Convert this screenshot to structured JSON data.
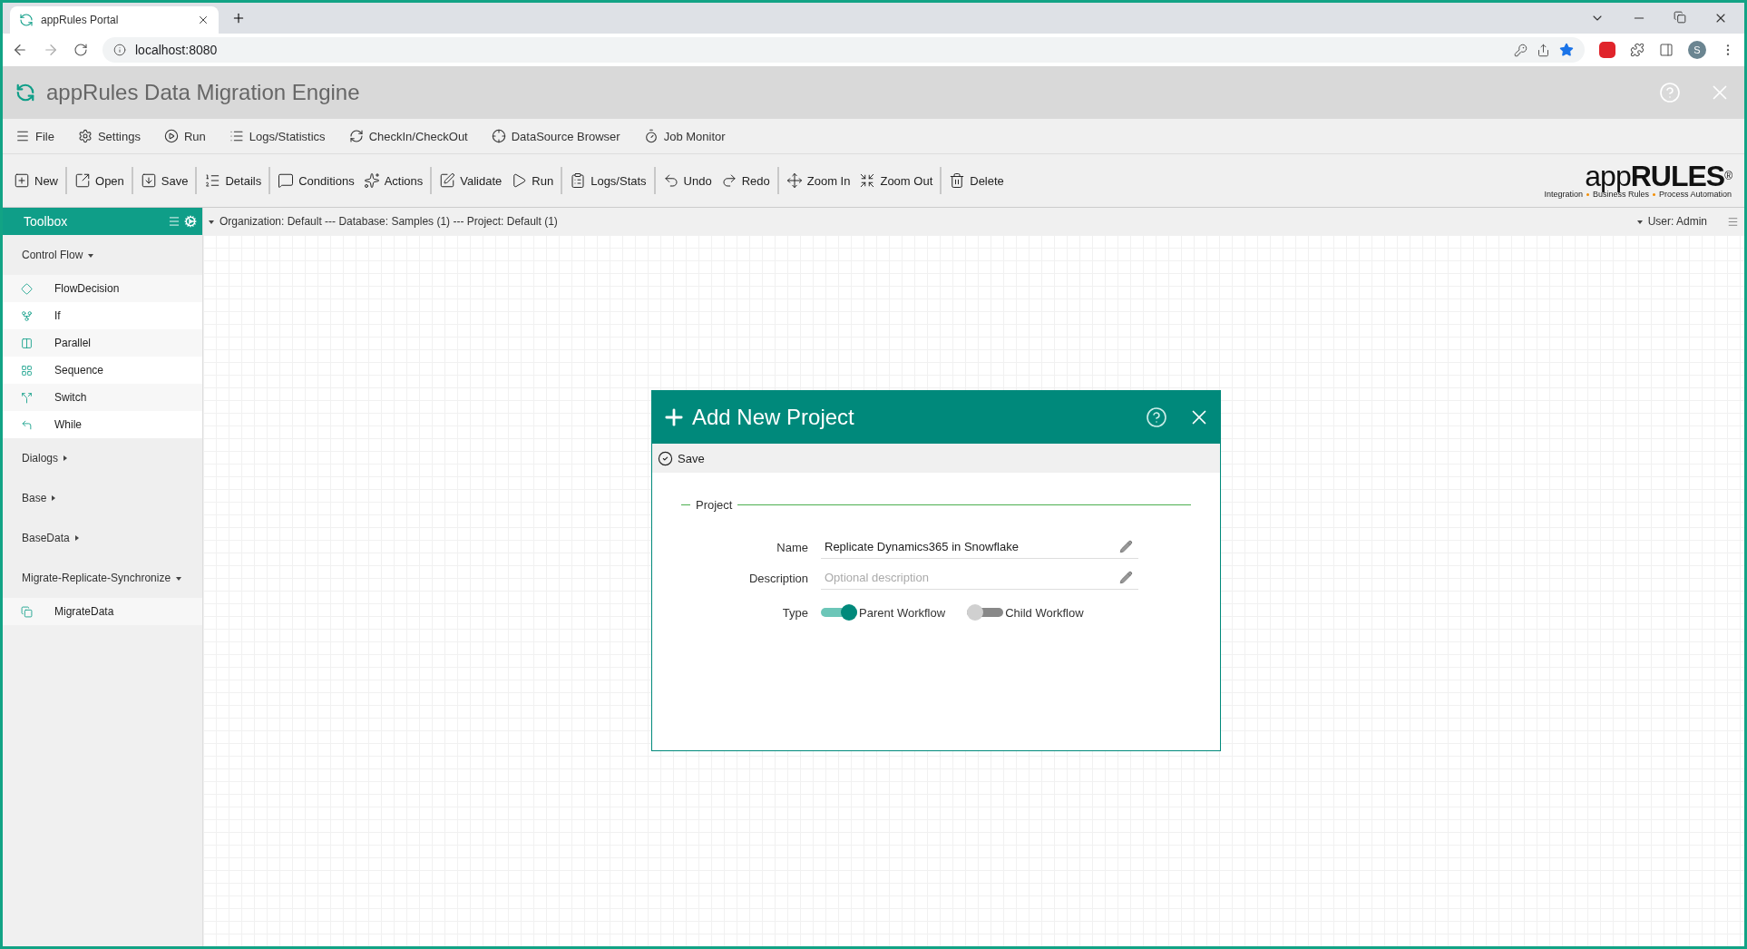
{
  "browser": {
    "tab_title": "appRules Portal",
    "url": "localhost:8080",
    "profile_initial": "S"
  },
  "app": {
    "title": "appRules Data Migration Engine"
  },
  "menu": [
    {
      "label": "File"
    },
    {
      "label": "Settings"
    },
    {
      "label": "Run"
    },
    {
      "label": "Logs/Statistics"
    },
    {
      "label": "CheckIn/CheckOut"
    },
    {
      "label": "DataSource Browser"
    },
    {
      "label": "Job Monitor"
    }
  ],
  "toolbar": [
    [
      {
        "label": "New"
      }
    ],
    [
      {
        "label": "Open"
      }
    ],
    [
      {
        "label": "Save"
      }
    ],
    [
      {
        "label": "Details"
      }
    ],
    [
      {
        "label": "Conditions"
      },
      {
        "label": "Actions"
      }
    ],
    [
      {
        "label": "Validate"
      },
      {
        "label": "Run"
      }
    ],
    [
      {
        "label": "Logs/Stats"
      }
    ],
    [
      {
        "label": "Undo"
      },
      {
        "label": "Redo"
      }
    ],
    [
      {
        "label": "Zoom In"
      },
      {
        "label": "Zoom Out"
      }
    ],
    [
      {
        "label": "Delete"
      }
    ]
  ],
  "logo": {
    "wordmark": "app**RULES**$^{®}$",
    "tagline": [
      "Integration",
      "Business Rules",
      "Process Automation"
    ]
  },
  "toolbox": {
    "title": "Toolbox",
    "groups": [
      {
        "label": "Control Flow",
        "expanded": true,
        "items": [
          {
            "label": "FlowDecision"
          },
          {
            "label": "If"
          },
          {
            "label": "Parallel"
          },
          {
            "label": "Sequence"
          },
          {
            "label": "Switch"
          },
          {
            "label": "While"
          }
        ]
      },
      {
        "label": "Dialogs",
        "expanded": false
      },
      {
        "label": "Base",
        "expanded": false
      },
      {
        "label": "BaseData",
        "expanded": false
      },
      {
        "label": "Migrate-Replicate-Synchronize",
        "expanded": true,
        "items": [
          {
            "label": "MigrateData"
          }
        ]
      }
    ]
  },
  "breadcrumb": {
    "path": "Organization: Default --- Database: Samples (1) --- Project: Default (1)",
    "user": "User: Admin"
  },
  "dialog": {
    "title": "Add New Project",
    "save_label": "Save",
    "section": "Project",
    "fields": [
      {
        "label": "Name",
        "value": "Replicate Dynamics365 in Snowflake"
      },
      {
        "label": "Description",
        "placeholder": "Optional description"
      }
    ],
    "type": {
      "label": "Type",
      "options": [
        {
          "label": "Parent Workflow",
          "on": true
        },
        {
          "label": "Child Workflow",
          "on": false
        }
      ]
    }
  }
}
